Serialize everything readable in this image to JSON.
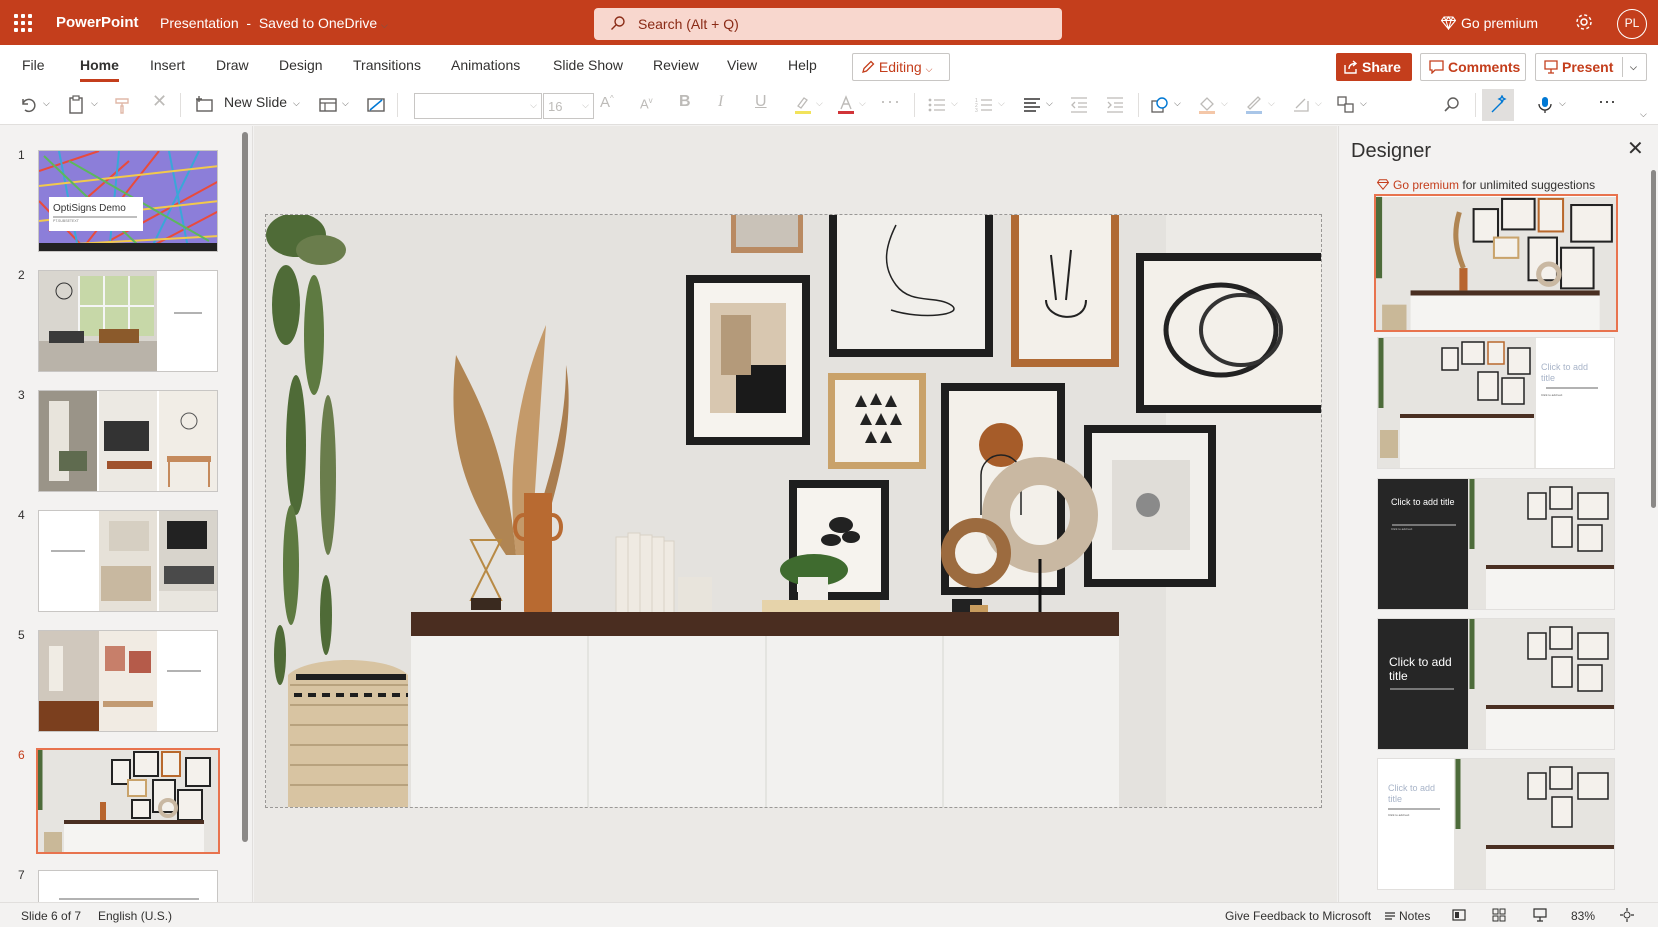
{
  "app": {
    "name": "PowerPoint",
    "document": "Presentation",
    "save_status": "Saved to OneDrive",
    "search_placeholder": "Search (Alt + Q)",
    "go_premium": "Go premium",
    "user_initials": "PL"
  },
  "menu": {
    "tabs": [
      "File",
      "Home",
      "Insert",
      "Draw",
      "Design",
      "Transitions",
      "Animations",
      "Slide Show",
      "Review",
      "View",
      "Help"
    ],
    "active_tab": "Home",
    "editing_label": "Editing",
    "share_label": "Share",
    "comments_label": "Comments",
    "present_label": "Present"
  },
  "toolbar": {
    "new_slide_label": "New Slide",
    "font_name": "",
    "font_size": "16"
  },
  "slides": {
    "count": 7,
    "active": 6,
    "items": [
      {
        "number": "1",
        "title": "OptiSigns Demo",
        "subtitle": "PT.SUBSETEXT"
      },
      {
        "number": "2"
      },
      {
        "number": "3"
      },
      {
        "number": "4"
      },
      {
        "number": "5"
      },
      {
        "number": "6"
      },
      {
        "number": "7"
      }
    ]
  },
  "designer": {
    "title": "Designer",
    "premium_link": "Go premium",
    "premium_text": "for unlimited suggestions",
    "cards": [
      {
        "title_placeholder": "",
        "text_placeholder": ""
      },
      {
        "title_placeholder": "Click to add title",
        "text_placeholder": "Click to add text"
      },
      {
        "title_placeholder": "Click to add title",
        "text_placeholder": "Click to add text"
      },
      {
        "title_placeholder": "Click to add title",
        "text_placeholder": ""
      },
      {
        "title_placeholder": "Click to add title",
        "text_placeholder": "Click to add text"
      }
    ]
  },
  "status": {
    "slide_info": "Slide 6 of 7",
    "language": "English (U.S.)",
    "feedback": "Give Feedback to Microsoft",
    "notes": "Notes",
    "zoom": "83%"
  },
  "colors": {
    "brand": "#c43e1c",
    "selection": "#e8734e"
  }
}
